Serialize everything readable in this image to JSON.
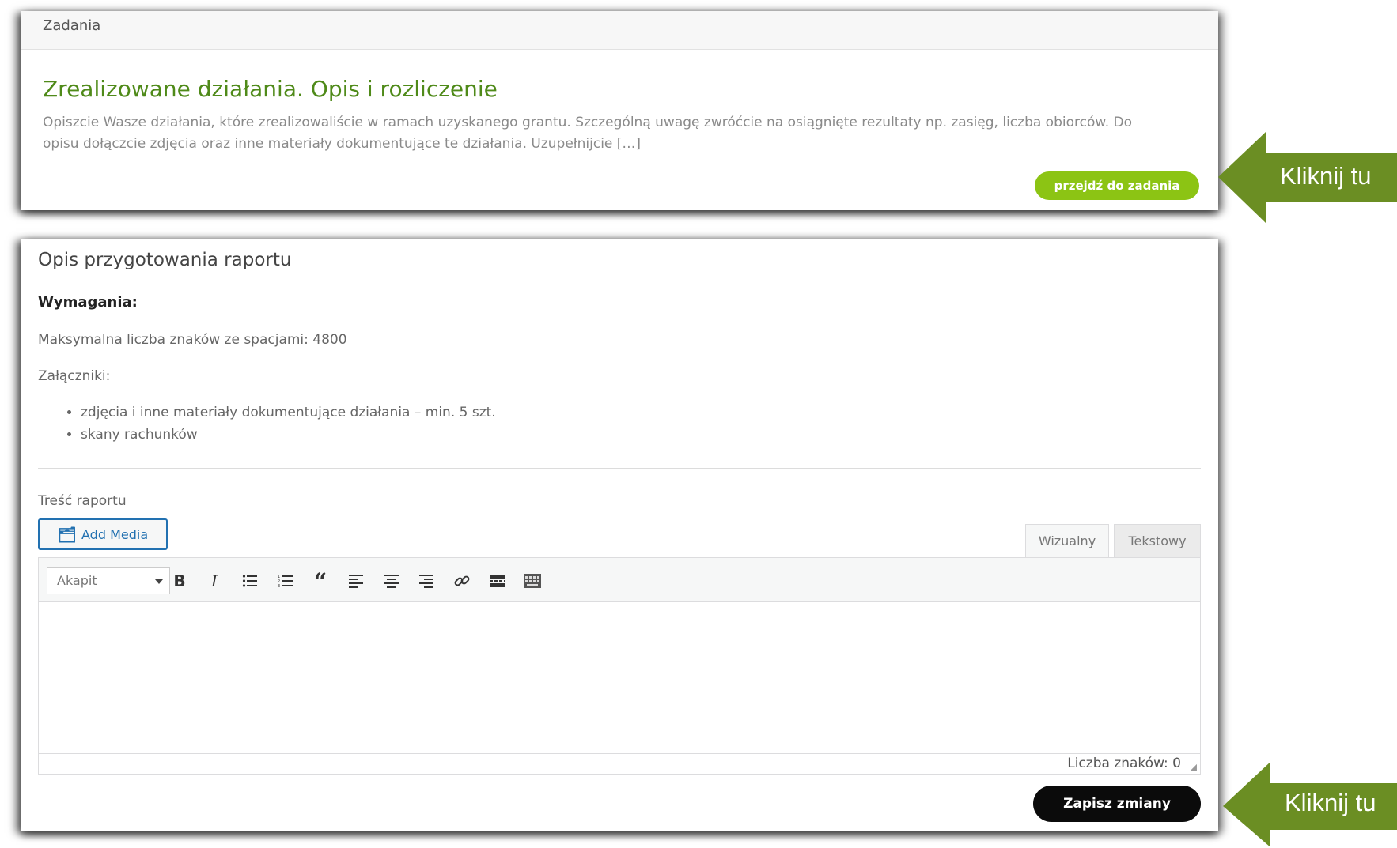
{
  "task_panel": {
    "header": "Zadania",
    "title": "Zrealizowane działania. Opis i rozliczenie",
    "description": "Opiszcie Wasze działania, które zrealizowaliście w ramach uzyskanego grantu. Szczególną uwagę zwróćcie na osiągnięte rezultaty np. zasięg, liczba obiorców. Do opisu dołączcie zdjęcia oraz inne materiały dokumentujące te działania. Uzupełnijcie […]",
    "button": "przejdź do zadania"
  },
  "report_panel": {
    "title": "Opis przygotowania raportu",
    "requirements_heading": "Wymagania:",
    "max_chars": "Maksymalna liczba znaków ze spacjami: 4800",
    "attachments_label": "Załączniki:",
    "attachments": [
      "zdjęcia i inne materiały dokumentujące działania – min. 5 szt.",
      "skany rachunków"
    ],
    "content_label": "Treść raportu",
    "add_media": "Add Media",
    "tab_visual": "Wizualny",
    "tab_text": "Tekstowy",
    "format_select": "Akapit",
    "char_count": "Liczba znaków: 0",
    "save_button": "Zapisz zmiany"
  },
  "toolbar_icons": [
    "bold-icon",
    "italic-icon",
    "bullet-list-icon",
    "numbered-list-icon",
    "blockquote-icon",
    "align-left-icon",
    "align-center-icon",
    "align-right-icon",
    "link-icon",
    "read-more-icon",
    "toolbar-toggle-icon"
  ],
  "callouts": [
    "Kliknij tu",
    "Kliknij tu"
  ],
  "colors": {
    "green_accent": "#4f8a19",
    "green_button": "#8cc414",
    "callout_green": "#6b8e23",
    "save_button": "#0b0b0b",
    "media_blue": "#2271b1"
  }
}
